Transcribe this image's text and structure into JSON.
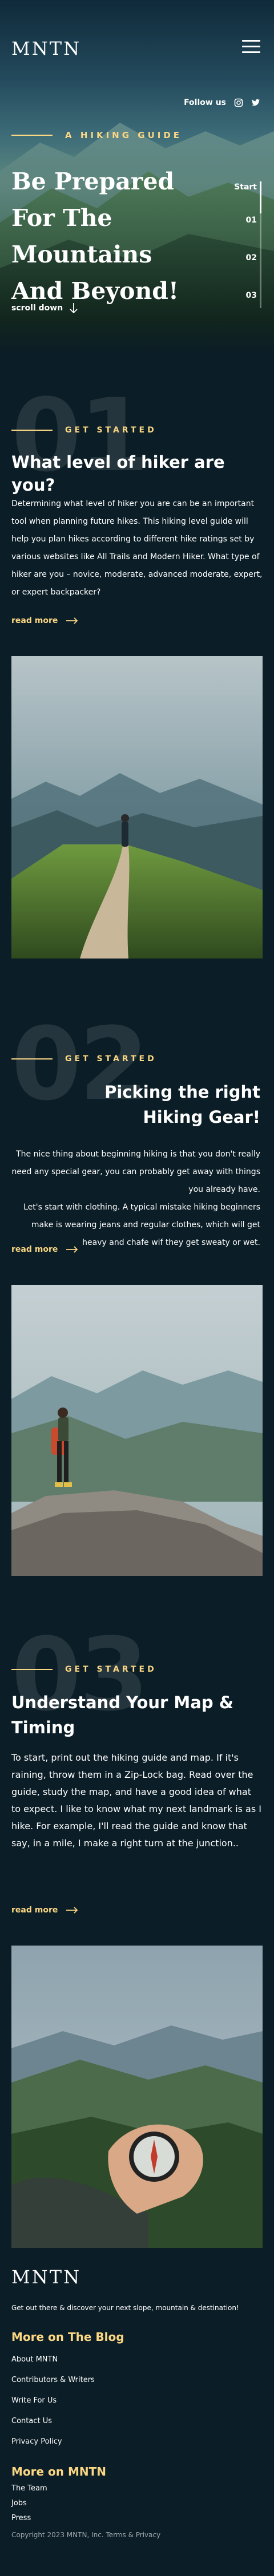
{
  "brand": {
    "logo": "MNTN"
  },
  "hero": {
    "follow_label": "Follow us",
    "eyebrow": "A HIKING GUIDE",
    "title": "Be Prepared For The Mountains And Beyond!",
    "scroll_label": "scroll down",
    "nav_start": "Start",
    "nav_items": [
      "01",
      "02",
      "03"
    ]
  },
  "sections": [
    {
      "number": "01",
      "eyebrow": "GET STARTED",
      "title": "What level of  hiker are you?",
      "body": "Determining what level of hiker you are can be an important tool when planning future hikes. This hiking level guide will help you plan hikes according to different hike ratings set by various websites like All Trails and Modern Hiker. What type of hiker are you – novice, moderate, advanced moderate, expert, or expert backpacker?",
      "read_more": "read more"
    },
    {
      "number": "02",
      "eyebrow": "GET STARTED",
      "title": "Picking the right Hiking Gear!",
      "body": "The nice thing about beginning hiking is that you don't really need any special gear, you can probably get away with things you already have.\nLet's start with clothing. A typical mistake hiking beginners make is wearing jeans and regular clothes, which will get heavy and chafe wif they get sweaty or wet.",
      "read_more": "read more"
    },
    {
      "number": "03",
      "eyebrow": "GET STARTED",
      "title": "Understand Your Map & Timing",
      "body": "To start, print out the hiking guide and map. If it's raining, throw them in a Zip-Lock bag. Read over the guide, study the map, and have a good idea of what to expect. I like to know what my next landmark is as I hike. For example, I'll read the guide and know that say, in a mile, I make a right turn at the junction..",
      "read_more": "read more"
    }
  ],
  "footer": {
    "logo": "MNTN",
    "tagline": "Get out there & discover your next slope, mountain & destination!",
    "blog_heading": "More on The Blog",
    "blog_links": [
      "About MNTN",
      "Contributors & Writers",
      "Write For Us",
      "Contact Us",
      "Privacy Policy"
    ],
    "more_heading": "More on MNTN",
    "more_links": [
      "The Team",
      "Jobs",
      "Press"
    ],
    "copyright": "Copyright 2023 MNTN, Inc. Terms & Privacy"
  },
  "colors": {
    "background": "#0b1d26",
    "accent": "#fbd784",
    "text": "#ffffff"
  },
  "icons": [
    "hamburger-menu-icon",
    "instagram-icon",
    "twitter-icon",
    "arrow-down-icon",
    "arrow-right-icon"
  ]
}
